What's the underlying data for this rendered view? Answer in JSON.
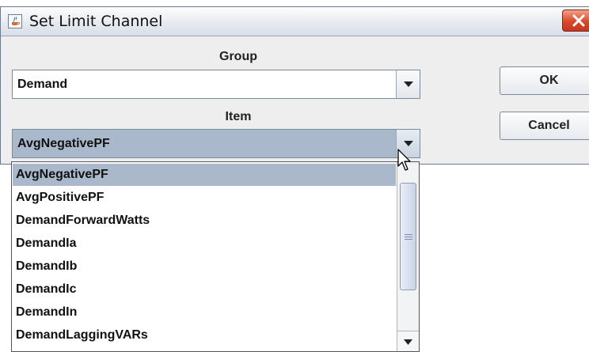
{
  "window": {
    "title": "Set Limit Channel",
    "icons": {
      "app": "java-cup-icon",
      "close": "close-icon"
    }
  },
  "group": {
    "label": "Group",
    "selected": "Demand"
  },
  "item": {
    "label": "Item",
    "selected": "AvgNegativePF"
  },
  "buttons": {
    "ok": "OK",
    "cancel": "Cancel"
  },
  "dropdown": {
    "items": [
      "AvgNegativePF",
      "AvgPositivePF",
      "DemandForwardWatts",
      "DemandIa",
      "DemandIb",
      "DemandIc",
      "DemandIn",
      "DemandLaggingVARs"
    ],
    "selected_index": 0
  },
  "colors": {
    "selection": "#a9b8cb",
    "dialog_bg": "#eeeeee",
    "close_button": "#d8482a"
  }
}
